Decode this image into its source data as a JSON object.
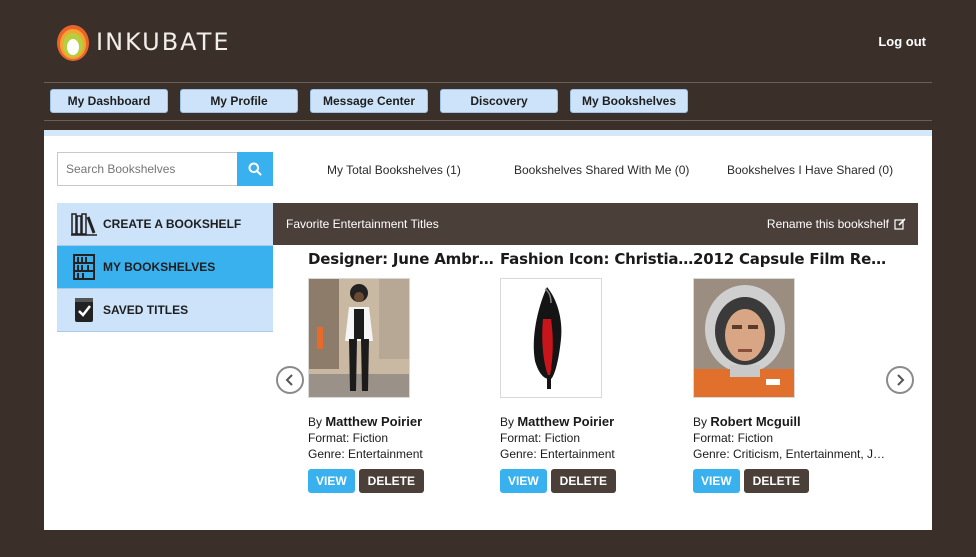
{
  "header": {
    "brand": "INKUBATE",
    "logout": "Log out"
  },
  "nav": [
    {
      "label": "My Dashboard"
    },
    {
      "label": "My Profile"
    },
    {
      "label": "Message Center"
    },
    {
      "label": "Discovery"
    },
    {
      "label": "My Bookshelves"
    }
  ],
  "search": {
    "placeholder": "Search Bookshelves",
    "icon": "search-icon"
  },
  "stats": {
    "total": "My Total Bookshelves (1)",
    "shared_with_me": "Bookshelves Shared With Me (0)",
    "i_have_shared": "Bookshelves I Have Shared (0)"
  },
  "sidebar": [
    {
      "label": "CREATE A BOOKSHELF",
      "icon": "books-icon",
      "active": false
    },
    {
      "label": "MY BOOKSHELVES",
      "icon": "bookcase-icon",
      "active": true
    },
    {
      "label": "SAVED TITLES",
      "icon": "book-check-icon",
      "active": false
    }
  ],
  "shelf": {
    "name": "Favorite Entertainment Titles",
    "rename": "Rename this bookshelf"
  },
  "cards": [
    {
      "title": "Designer: June Ambr…",
      "by_prefix": "By ",
      "author": "Matthew Poirier",
      "format": "Format: Fiction",
      "genre": "Genre: Entertainment",
      "view": "VIEW",
      "delete": "DELETE"
    },
    {
      "title": "Fashion Icon: Christia…",
      "by_prefix": "By ",
      "author": "Matthew Poirier",
      "format": "Format: Fiction",
      "genre": "Genre: Entertainment",
      "view": "VIEW",
      "delete": "DELETE"
    },
    {
      "title": "2012 Capsule Film Re…",
      "by_prefix": "By ",
      "author": "Robert Mcguill",
      "format": "Format: Fiction",
      "genre": "Genre: Criticism, Entertainment, J…",
      "view": "VIEW",
      "delete": "DELETE"
    }
  ],
  "colors": {
    "background": "#3b2f2a",
    "accent": "#3ab1ef",
    "nav_button": "#cce3f9",
    "dark_button": "#4a3f39"
  }
}
